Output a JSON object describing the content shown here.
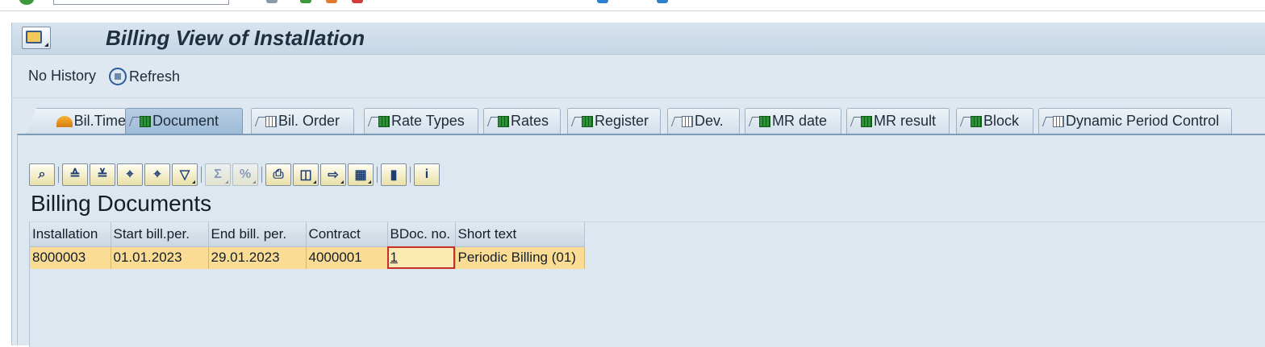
{
  "window": {
    "title": "Billing View of Installation"
  },
  "toolbar": {
    "no_history_label": "No History",
    "refresh_label": "Refresh"
  },
  "tabs": [
    {
      "label": "Bil.Time",
      "icon": "sun-icon",
      "active": false
    },
    {
      "label": "Document",
      "icon": "table-green-icon",
      "active": true
    },
    {
      "label": "Bil. Order",
      "icon": "table-icon",
      "active": false
    },
    {
      "label": "Rate Types",
      "icon": "table-green-icon",
      "active": false
    },
    {
      "label": "Rates",
      "icon": "table-green-icon",
      "active": false
    },
    {
      "label": "Register",
      "icon": "table-green-icon",
      "active": false
    },
    {
      "label": "Dev.",
      "icon": "table-icon",
      "active": false
    },
    {
      "label": "MR date",
      "icon": "table-green-icon",
      "active": false
    },
    {
      "label": "MR result",
      "icon": "table-green-icon",
      "active": false
    },
    {
      "label": "Block",
      "icon": "table-green-icon",
      "active": false
    },
    {
      "label": "Dynamic Period Control",
      "icon": "table-icon",
      "active": false
    }
  ],
  "grid": {
    "title": "Billing Documents",
    "toolbar_buttons": [
      "details-icon",
      "sort-ascending-icon",
      "sort-descending-icon",
      "find-icon",
      "find-next-icon",
      "filter-icon",
      "total-icon",
      "subtotal-icon",
      "print-icon",
      "views-icon",
      "export-icon",
      "layout-icon",
      "graphic-icon",
      "info-icon"
    ],
    "columns": [
      "Installation",
      "Start bill.per.",
      "End bill. per.",
      "Contract",
      "BDoc. no.",
      "Short text"
    ],
    "rows": [
      [
        "8000003",
        "01.01.2023",
        "29.01.2023",
        "4000001",
        "1",
        "Periodic Billing (01)"
      ]
    ]
  },
  "colors": {
    "row_highlight": "#fbdc95",
    "tab_active": "#a9c4de",
    "background": "#dfe8f0"
  }
}
